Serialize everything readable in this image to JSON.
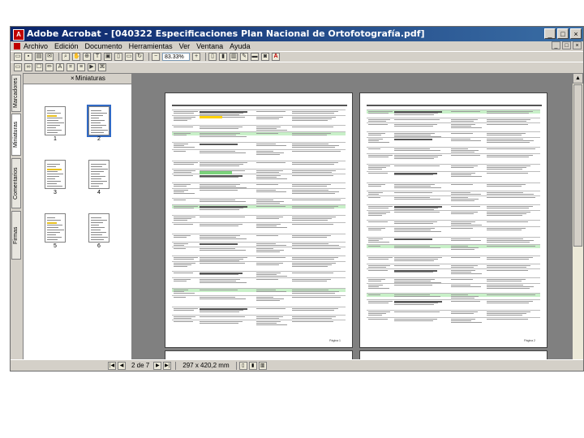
{
  "window": {
    "title": "Adobe Acrobat - [040322 Especificaciones Plan Nacional de Ortofotografía.pdf]",
    "controls": [
      "_",
      "□",
      "×"
    ]
  },
  "menu": {
    "items": [
      "Archivo",
      "Edición",
      "Documento",
      "Herramientas",
      "Ver",
      "Ventana",
      "Ayuda"
    ],
    "doc_controls": [
      "_",
      "□",
      "×"
    ]
  },
  "toolbar": {
    "zoom": "83.33%"
  },
  "left_tabs": [
    "Firmas",
    "Comentarios",
    "Miniaturas",
    "Marcadores"
  ],
  "thumbnails": {
    "header": "Miniaturas",
    "pages": [
      "1",
      "2",
      "3",
      "4",
      "5",
      "6"
    ]
  },
  "status": {
    "page_info": "2 de 7",
    "page_size": "297 x 420,2 mm"
  },
  "pages": {
    "left_footer": "Página 1",
    "right_footer": "Página 2"
  },
  "colors": {
    "title_start": "#0a246a",
    "title_end": "#3a6ea5",
    "highlight_yellow": "#ffd200",
    "highlight_green": "#7cd37c",
    "section_green": "#c8f0c8"
  }
}
